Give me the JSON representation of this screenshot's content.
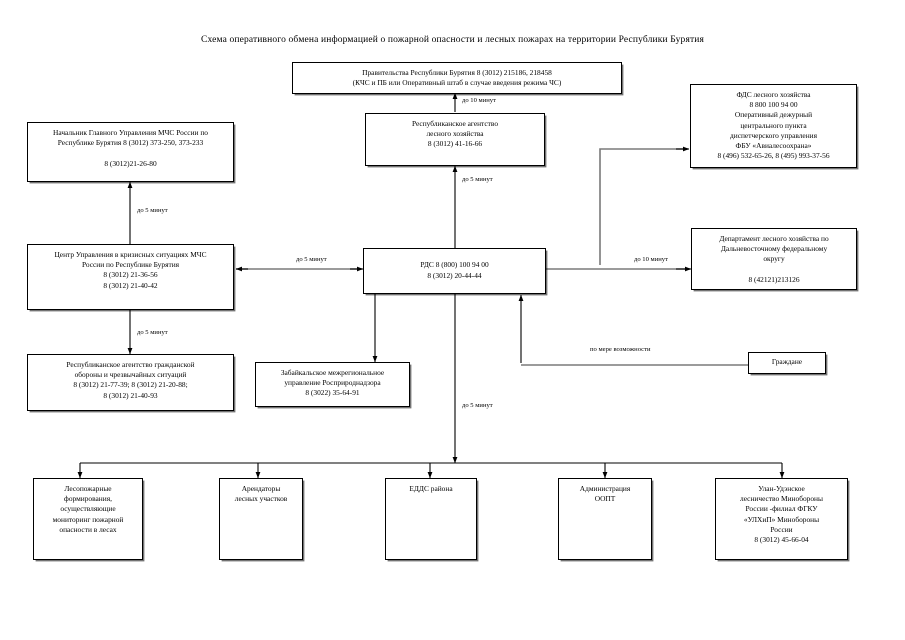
{
  "title": "Схема оперативного обмена информацией о пожарной опасности и лесных пожарах на территории Республики Бурятия",
  "nodes": {
    "government": {
      "name": "government-box",
      "text": "Правительства Республики Бурятия  8 (3012) 215186, 218458\n(КЧС и ПБ или Оперативный штаб в случае введения режима ЧС)"
    },
    "republican_forestry_agency": {
      "name": "republican-forestry-agency-box",
      "text": "Республиканское агентство\nлесного хозяйства\n8 (3012) 41-16-66"
    },
    "fds_forestry": {
      "name": "fds-forestry-box",
      "text": "ФДС лесного хозяйства\n8 800 100 94 00\nОперативный дежурный\nцентрального пункта\nдиспетчерского управления\nФБУ «Авиалесоохрана»\n8 (496) 532-65-26, 8 (495) 993-37-56"
    },
    "mchs_head": {
      "name": "mchs-head-box",
      "text": "Начальник Главного Управления МЧС России по\nРеспублике Бурятия 8 (3012) 373-250, 373-233\n\n8 (3012)21-26-80"
    },
    "crisis_center": {
      "name": "crisis-management-center-box",
      "text": "Центр Управления в кризисных ситуациях МЧС\nРоссии по Республике Бурятия\n8 (3012) 21-36-56\n8 (3012) 21-40-42"
    },
    "rds": {
      "name": "rds-box",
      "text": "РДС 8 (800) 100 94 00\n8 (3012) 20-44-44"
    },
    "far_east_dept": {
      "name": "far-east-forestry-department-box",
      "text": "Департамент лесного хозяйства по\nДальневосточному федеральному\nокругу\n\n8 (42121)213126"
    },
    "civil_defence_agency": {
      "name": "civil-defence-agency-box",
      "text": "Республиканское агентство гражданской\nобороны и чрезвычайных ситуаций\n8 (3012) 21-77-39; 8 (3012) 21-20-88;\n8 (3012) 21-40-93"
    },
    "rosprirodnadzor": {
      "name": "rosprirodnadzor-box",
      "text": "Забайкальское межрегиональное\nуправление Росприроднадзора\n8 (3022) 35-64-91"
    },
    "citizens": {
      "name": "citizens-box",
      "text": "Граждане"
    },
    "fire_units": {
      "name": "fire-fighting-units-box",
      "text": "Лесопожарные\nформирования,\nосуществляющие\nмониторинг пожарной\nопасности в лесах"
    },
    "tenants": {
      "name": "forest-plot-tenants-box",
      "text": "Арендаторы\nлесных участков"
    },
    "eddc": {
      "name": "eddc-district-box",
      "text": "ЕДДС района"
    },
    "oopt_admin": {
      "name": "oopt-administration-box",
      "text": "Администрация\nООПТ"
    },
    "ulan_ude_forestry": {
      "name": "ulan-ude-military-forestry-box",
      "text": "Улан-Удэнское\nлесничество Минобороны\nРоссии -филиал ФГКУ\n«УЛХиП» Минобороны\nРоссии\n8 (3012) 45-66-04"
    }
  },
  "edge_labels": [
    {
      "id": "gov-agency",
      "text": "до 10 минут"
    },
    {
      "id": "agency-rds",
      "text": "до 5 минут"
    },
    {
      "id": "mchs-crisis",
      "text": "до 5 минут"
    },
    {
      "id": "crisis-rds",
      "text": "до 5 минут"
    },
    {
      "id": "rds-fareast",
      "text": "до 10 минут"
    },
    {
      "id": "crisis-civildefence",
      "text": "до 5 минут"
    },
    {
      "id": "rds-bottom",
      "text": "до 5 минут"
    },
    {
      "id": "citizens-rds",
      "text": "по мере возможности"
    }
  ]
}
